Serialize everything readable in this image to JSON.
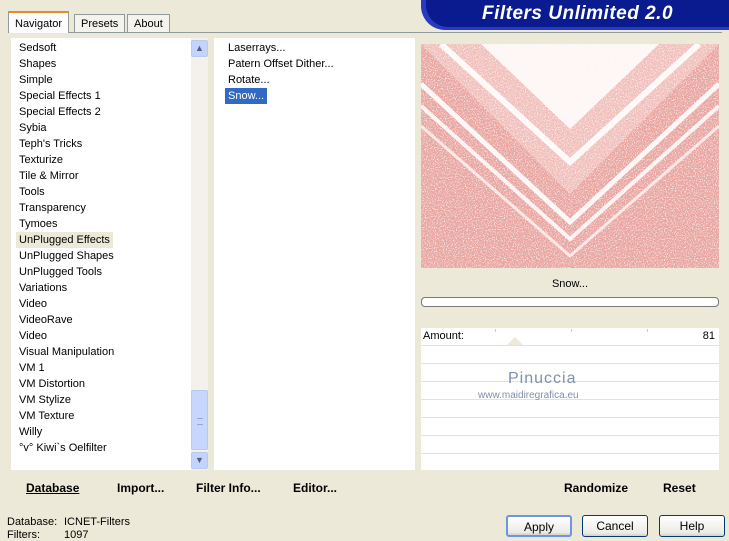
{
  "tabs": [
    {
      "label": "Navigator",
      "active": true
    },
    {
      "label": "Presets",
      "active": false
    },
    {
      "label": "About",
      "active": false
    }
  ],
  "app_title": "Filters Unlimited 2.0",
  "categories": [
    "Sedsoft",
    "Shapes",
    "Simple",
    "Special Effects 1",
    "Special Effects 2",
    "Sybia",
    "Teph's Tricks",
    "Texturize",
    "Tile & Mirror",
    "Tools",
    "Transparency",
    "Tymoes",
    "UnPlugged Effects",
    "UnPlugged Shapes",
    "UnPlugged Tools",
    "Variations",
    "Video",
    "VideoRave",
    "Video",
    "Visual Manipulation",
    "VM 1",
    "VM Distortion",
    "VM Stylize",
    "VM Texture",
    "Willy",
    "°v° Kiwi`s Oelfilter"
  ],
  "selected_category": "UnPlugged Effects",
  "filters": [
    "Laserrays...",
    "Patern Offset Dither...",
    "Rotate...",
    "Snow..."
  ],
  "selected_filter": "Snow...",
  "preview": {
    "base_color": "#E9A5A0",
    "highlight_color": "#FFFFFF",
    "filter_name": "Snow..."
  },
  "params": {
    "amount_label": "Amount:",
    "amount_value": "81"
  },
  "watermark": {
    "name": "Pinuccia",
    "url": "www.maidiregrafica.eu"
  },
  "bottom_left": {
    "database": "Database",
    "import": "Import...",
    "filter_info": "Filter Info...",
    "editor": "Editor..."
  },
  "bottom_right": {
    "randomize": "Randomize",
    "reset": "Reset"
  },
  "status": {
    "database_label": "Database:",
    "database_value": "ICNET-Filters",
    "filters_label": "Filters:",
    "filters_value": "1097"
  },
  "dialog_buttons": {
    "apply": "Apply",
    "cancel": "Cancel",
    "help": "Help"
  },
  "icons": {
    "scroll_up": "chevron-up-icon",
    "scroll_down": "chevron-down-icon"
  },
  "colors": {
    "banner_bg": "#0A1B8F",
    "selection_blue": "#316AC5",
    "panel_bg": "#ECE9D8"
  }
}
